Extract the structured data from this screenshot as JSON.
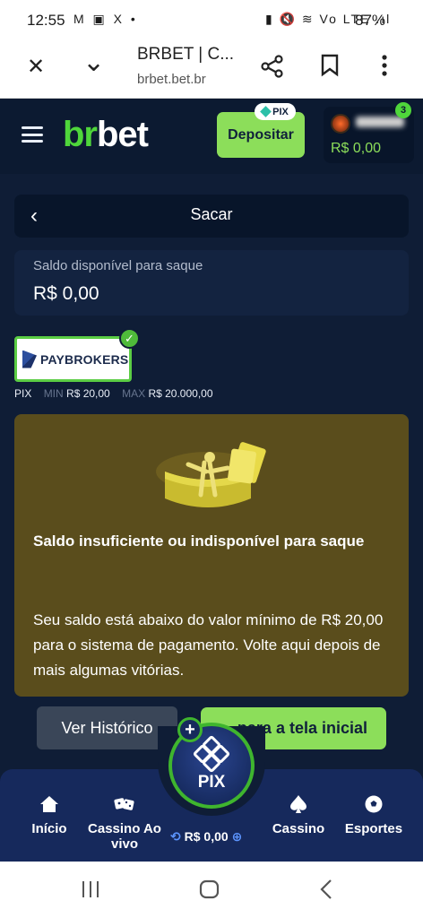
{
  "status_bar": {
    "time": "12:55",
    "notification_icons": "M ▣ X •",
    "system_icons": "▮ 🔇 ≋ Vo LTE .ıl",
    "battery": "87%"
  },
  "browser": {
    "page_title": "BRBET | C...",
    "url": "brbet.bet.br",
    "close_glyph": "✕",
    "chevron_glyph": "⌄"
  },
  "header": {
    "logo_green": "br",
    "logo_white": "bet",
    "deposit_label": "Depositar",
    "pix_badge": "PIX",
    "user_balance": "R$ 0,00",
    "notification_count": "3"
  },
  "withdraw": {
    "back_glyph": "‹",
    "title": "Sacar",
    "balance_label": "Saldo disponível para saque",
    "balance_value": "R$ 0,00"
  },
  "payment_method": {
    "name": "PAYBROKERS",
    "type": "PIX",
    "min_label": "MIN",
    "min_value": "R$ 20,00",
    "max_label": "MAX",
    "max_value": "R$ 20.000,00",
    "selected": true
  },
  "warning": {
    "heading": "Saldo insuficiente ou indisponível para saque",
    "message": "Seu saldo está abaixo do valor mínimo de R$ 20,00 para o sistema de pagamento. Volte aqui depois de mais algumas vitórias."
  },
  "actions": {
    "history_label": "Ver Histórico",
    "home_label": "para a tela inicial"
  },
  "bottom_nav": {
    "items": [
      {
        "label": "Início",
        "icon": "home-icon"
      },
      {
        "label": "Cassino Ao vivo",
        "icon": "dice-icon"
      },
      {
        "label": "Cassino",
        "icon": "spade-icon"
      },
      {
        "label": "Esportes",
        "icon": "soccer-ball-icon"
      }
    ],
    "balance": "R$ 0,00",
    "pix_label": "PIX"
  },
  "colors": {
    "background": "#0f1d36",
    "accent_green": "#8cde5a",
    "warning_bg": "#5a4d1c",
    "nav_bg": "#16295c"
  }
}
